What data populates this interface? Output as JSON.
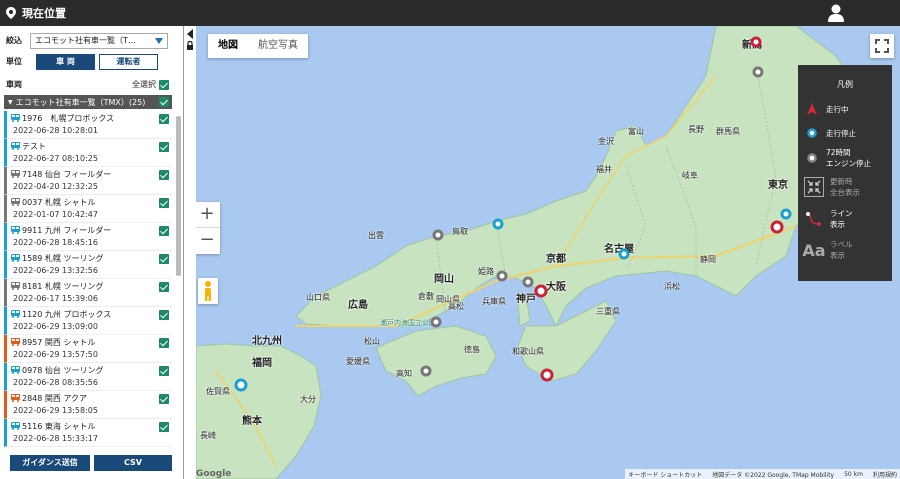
{
  "header": {
    "title": "現在位置"
  },
  "sidebar": {
    "narrow_label": "絞込",
    "narrow_value": "エコモット社有車一覧（T…",
    "unit_label": "単位",
    "unit_vehicle": "車 両",
    "unit_driver": "運転者",
    "vehicle_label": "車両",
    "select_all": "全選択",
    "group_title": "エコモット社有車一覧（TMX）(25)",
    "items": [
      {
        "name": "1976　札幌プロボックス",
        "time": "2022-06-28 10:28:01",
        "status": "moving"
      },
      {
        "name": "テスト",
        "time": "2022-06-27 08:10:25",
        "status": "moving"
      },
      {
        "name": "7148 仙台 フィールダー",
        "time": "2022-04-20 12:32:25",
        "status": "stopped"
      },
      {
        "name": "0037 札幌 シャトル",
        "time": "2022-01-07 10:42:47",
        "status": "stopped"
      },
      {
        "name": "9911 九州 フィールダー",
        "time": "2022-06-28 18:45:16",
        "status": "moving"
      },
      {
        "name": "1589 札幌 ツーリング",
        "time": "2022-06-29 13:32:56",
        "status": "moving"
      },
      {
        "name": "8181 札幌 ツーリング",
        "time": "2022-06-17 15:39:06",
        "status": "stopped"
      },
      {
        "name": "1120 九州 プロボックス",
        "time": "2022-06-29 13:09:00",
        "status": "moving"
      },
      {
        "name": "8957 関西 シャトル",
        "time": "2022-06-29 13:57:50",
        "status": "running"
      },
      {
        "name": "0978 仙台 ツーリング",
        "time": "2022-06-28 08:35:56",
        "status": "moving"
      },
      {
        "name": "2848 関西 アクア",
        "time": "2022-06-29 13:58:05",
        "status": "running"
      },
      {
        "name": "5116 東海 シャトル",
        "time": "2022-06-28 15:33:17",
        "status": "moving"
      }
    ],
    "guidance_button": "ガイダンス送信",
    "csv_button": "CSV"
  },
  "map": {
    "type_map": "地図",
    "type_satellite": "航空写真",
    "zoom_in": "+",
    "zoom_out": "−",
    "google": "Google",
    "shortcuts": "キーボード ショートカット",
    "map_data": "地図データ ©2022 Google, TMap Mobility",
    "scale": "50 km",
    "terms": "利用規約",
    "cities": [
      {
        "name": "新潟",
        "big": true
      },
      {
        "name": "金沢"
      },
      {
        "name": "富山"
      },
      {
        "name": "福井"
      },
      {
        "name": "岐阜"
      },
      {
        "name": "長野"
      },
      {
        "name": "名古屋",
        "big": true
      },
      {
        "name": "静岡"
      },
      {
        "name": "浜松"
      },
      {
        "name": "京都",
        "big": true
      },
      {
        "name": "大阪",
        "big": true
      },
      {
        "name": "神戸",
        "big": true
      },
      {
        "name": "姫路"
      },
      {
        "name": "岡山",
        "big": true
      },
      {
        "name": "広島",
        "big": true
      },
      {
        "name": "倉敷"
      },
      {
        "name": "高松"
      },
      {
        "name": "松山"
      },
      {
        "name": "徳島"
      },
      {
        "name": "高知"
      },
      {
        "name": "北九州",
        "big": true
      },
      {
        "name": "福岡",
        "big": true
      },
      {
        "name": "熊本",
        "big": true
      },
      {
        "name": "大分"
      },
      {
        "name": "長崎"
      },
      {
        "name": "佐賀県"
      },
      {
        "name": "和歌山県"
      },
      {
        "name": "三重県"
      },
      {
        "name": "出雲"
      },
      {
        "name": "鳥取"
      },
      {
        "name": "兵庫県"
      },
      {
        "name": "山口県"
      },
      {
        "name": "岡山県"
      },
      {
        "name": "愛媛県"
      },
      {
        "name": "群馬県"
      },
      {
        "name": "東京",
        "big": true
      },
      {
        "name": "瀬戸内海国立公園"
      }
    ]
  },
  "legend": {
    "title": "凡例",
    "running": "走行中",
    "stopped": "走行停止",
    "engine_off_1": "72時間",
    "engine_off_2": "エンジン停止",
    "change_1": "更新時",
    "change_2": "全台表示",
    "line_1": "ライン",
    "line_2": "表示",
    "label_1": "ラベル",
    "label_2": "表示"
  },
  "colors": {
    "header_bg": "#2b2b2b",
    "accent": "#1a4a7a",
    "check": "#1a8a6a",
    "moving": "#1aa0d0",
    "stopped": "#777777",
    "running": "#e05a1a",
    "sea": "#a9c9f1",
    "land": "#c7e3c0"
  }
}
